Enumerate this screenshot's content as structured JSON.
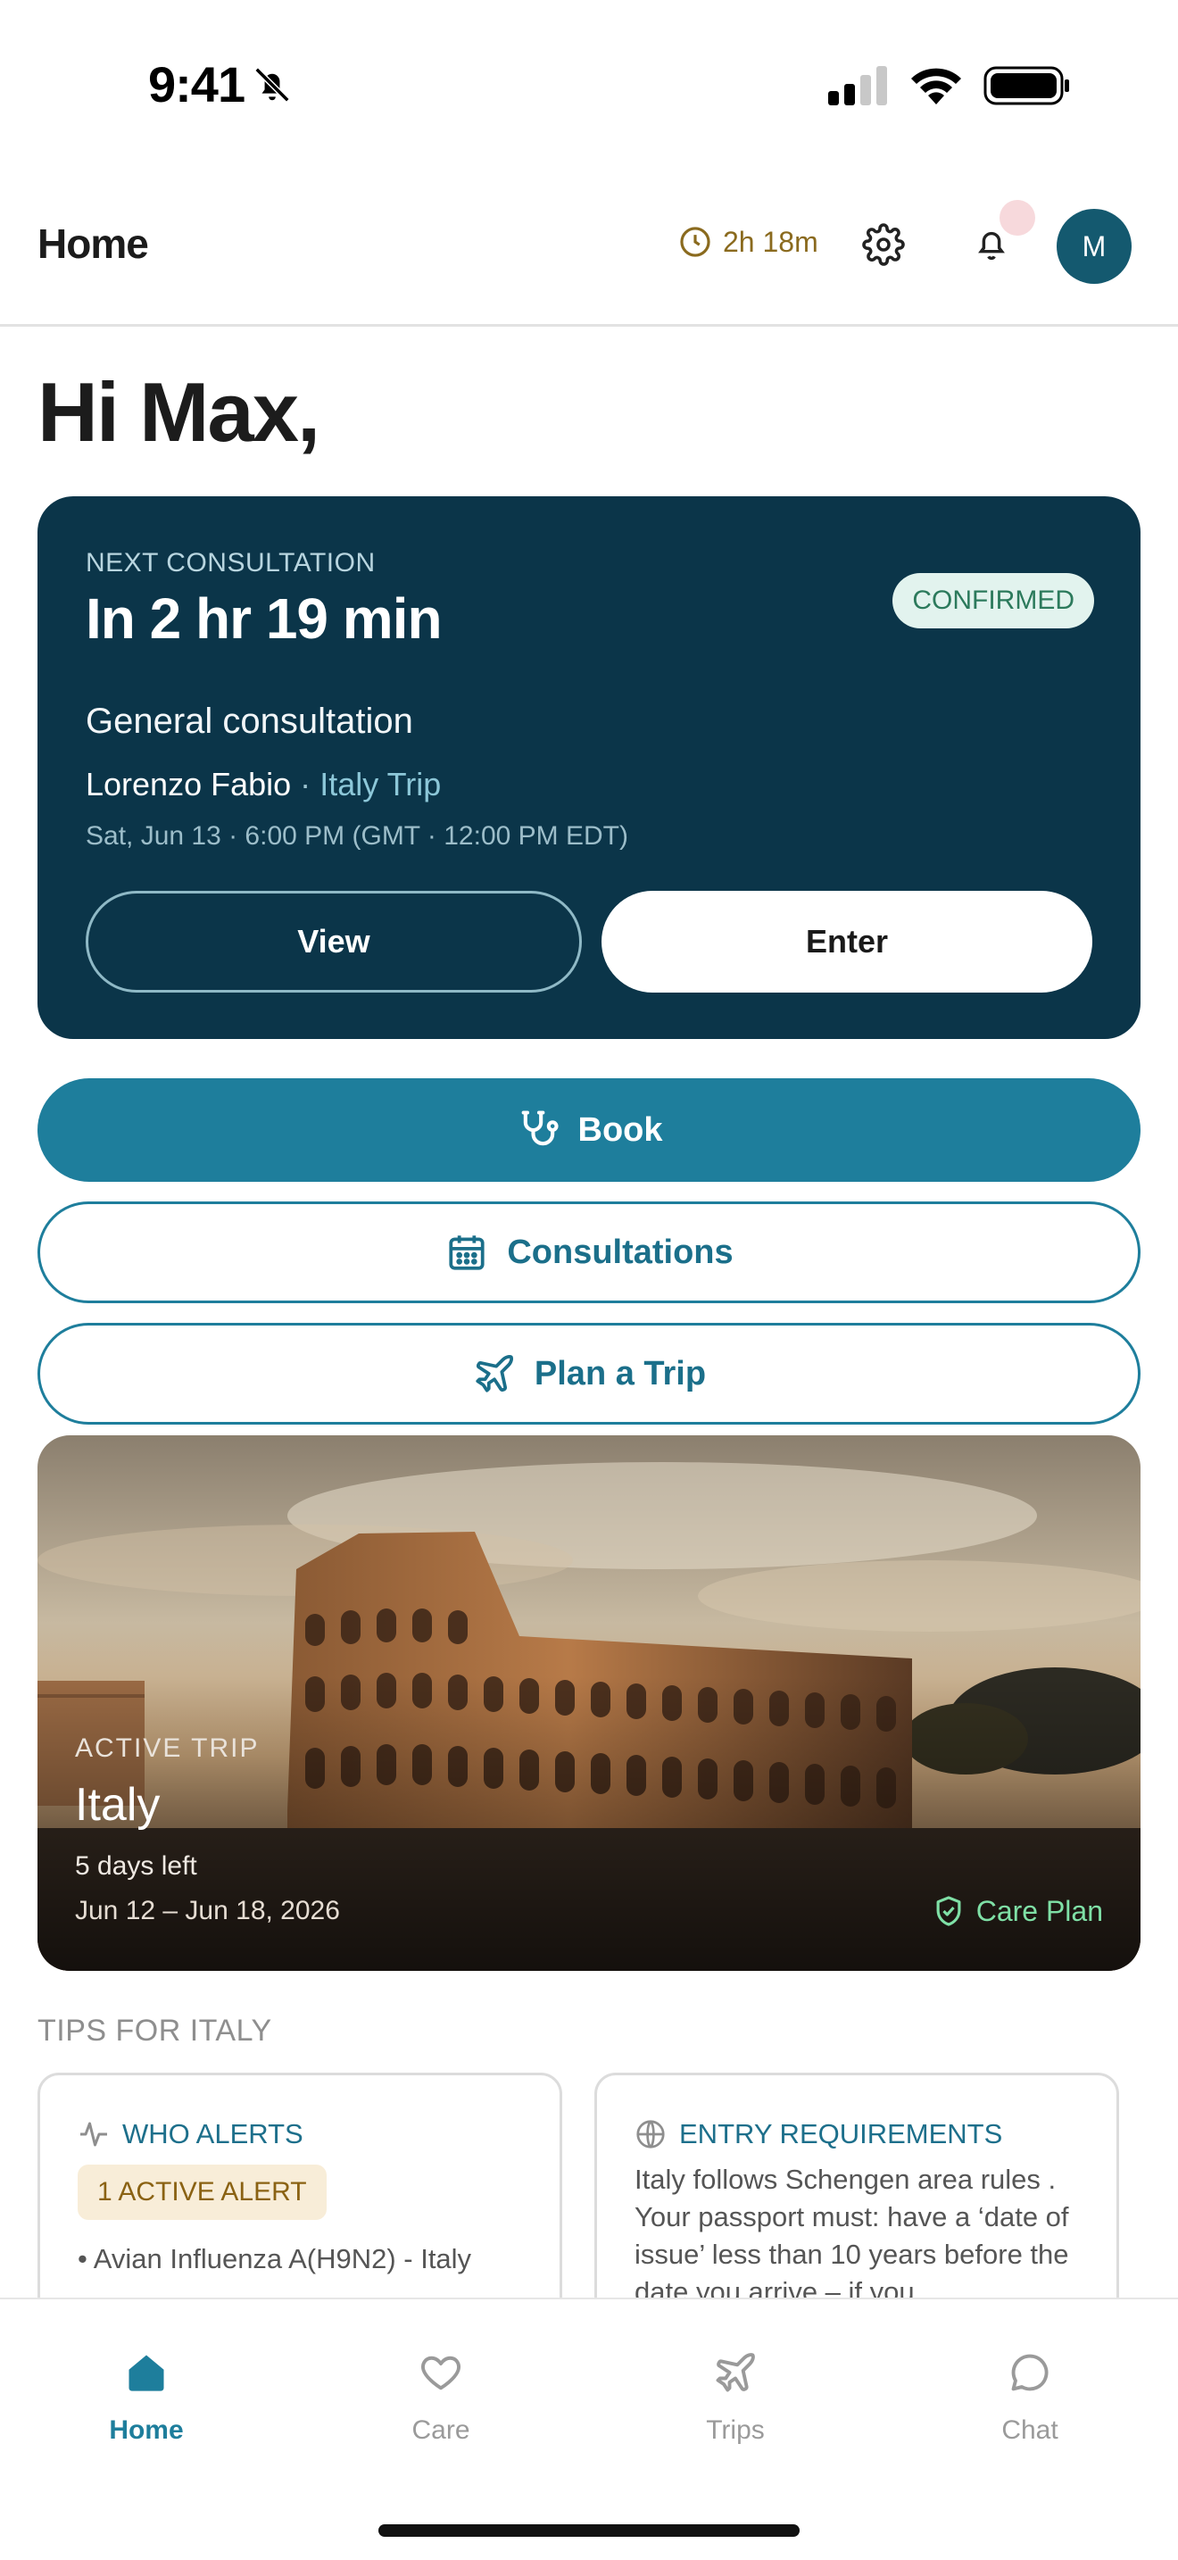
{
  "status_bar": {
    "time": "9:41"
  },
  "header": {
    "title": "Home",
    "timer": "2h 18m",
    "avatar_initial": "M"
  },
  "greeting": "Hi Max,",
  "consultation": {
    "eyebrow": "NEXT CONSULTATION",
    "countdown": "In 2 hr 19 min",
    "status": "CONFIRMED",
    "type": "General consultation",
    "doctor": "Lorenzo Fabio",
    "separator": "·",
    "trip": "Italy Trip",
    "datetime": "Sat, Jun 13 · 6:00 PM (GMT · 12:00 PM EDT)",
    "view_label": "View",
    "enter_label": "Enter"
  },
  "actions": {
    "book_label": "Book",
    "consultations_label": "Consultations",
    "plan_label": "Plan a Trip"
  },
  "trip": {
    "eyebrow": "ACTIVE TRIP",
    "name": "Italy",
    "days_left": "5 days left",
    "dates": "Jun 12 – Jun 18, 2026",
    "care_plan": "Care Plan"
  },
  "tips": {
    "title": "TIPS FOR ITALY",
    "who": {
      "title": "WHO ALERTS",
      "badge": "1 ACTIVE ALERT",
      "item": "• Avian Influenza A(H9N2) - Italy"
    },
    "entry": {
      "title": "ENTRY REQUIREMENTS",
      "body": "Italy follows Schengen area rules . Your passport must: have a ‘date of issue’ less than 10 years before the date you arrive – if you"
    }
  },
  "tab_bar": {
    "home": "Home",
    "care": "Care",
    "trips": "Trips",
    "chat": "Chat"
  },
  "colors": {
    "primary": "#1e7e9c",
    "card_dark": "#0b3549",
    "confirmed": "#2c7a5c",
    "care_plan": "#7fe0a6"
  }
}
